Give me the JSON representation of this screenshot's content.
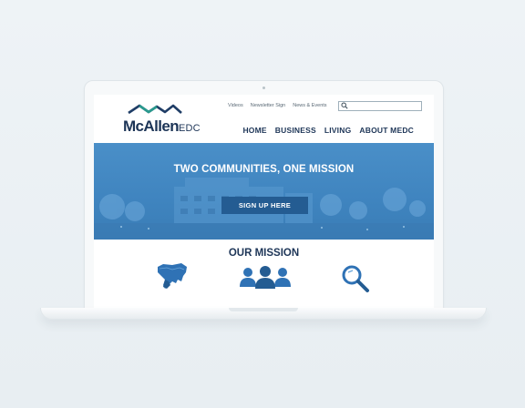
{
  "header": {
    "logo": {
      "main": "McAllen",
      "sub": "EDC"
    },
    "utility_links": [
      "Videos",
      "Newsletter Sign",
      "News & Events"
    ],
    "search": {
      "placeholder": "",
      "icon": "search-icon"
    },
    "nav": [
      "HOME",
      "BUSINESS",
      "LIVING",
      "ABOUT MEDC"
    ]
  },
  "hero": {
    "title": "TWO COMMUNITIES, ONE MISSION",
    "button": "SIGN UP HERE"
  },
  "mission": {
    "title": "OUR MISSION",
    "icons": [
      "map-icon",
      "people-icon",
      "magnifier-icon"
    ]
  },
  "colors": {
    "brand_navy": "#1d3557",
    "hero_blue": "#4a8fc8",
    "button_blue": "#245c92",
    "icon_blue": "#2f72b5"
  }
}
